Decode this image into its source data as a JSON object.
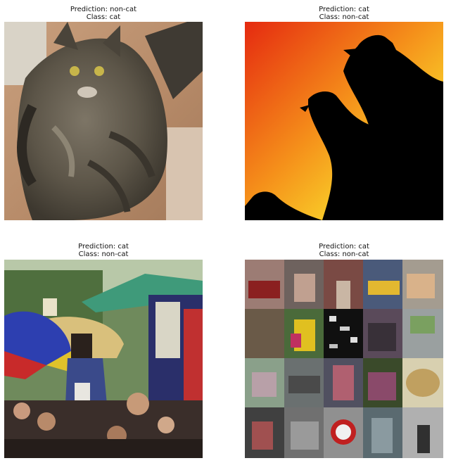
{
  "panels": [
    {
      "prediction": "Prediction: non-cat",
      "class": "Class: cat",
      "image": "cat-photo"
    },
    {
      "prediction": "Prediction: cat",
      "class": "Class: non-cat",
      "image": "birds-silhouette-sunset"
    },
    {
      "prediction": "Prediction: cat",
      "class": "Class: non-cat",
      "image": "street-market-crowd"
    },
    {
      "prediction": "Prediction: cat",
      "class": "Class: non-cat",
      "image": "photo-collage-grid"
    }
  ]
}
